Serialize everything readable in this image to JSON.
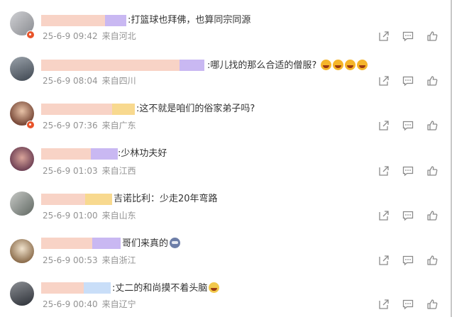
{
  "comments": [
    {
      "text": ":打篮球也拜佛，也算同宗同源",
      "date": "25-6-9 09:42",
      "location": "来自河北",
      "emoji_count": 0,
      "emoji": "",
      "vip": true
    },
    {
      "text": ":哪儿找的那么合适的僧服?",
      "date": "25-6-9 08:04",
      "location": "来自四川",
      "emoji_count": 4,
      "emoji": "laugh-cry-emoji",
      "vip": false
    },
    {
      "text": ":这不就是咱们的俗家弟子吗?",
      "date": "25-6-9 07:36",
      "location": "来自广东",
      "emoji_count": 0,
      "emoji": "",
      "vip": true
    },
    {
      "text": ":少林功夫好",
      "date": "25-6-9 01:03",
      "location": "来自江西",
      "emoji_count": 0,
      "emoji": "",
      "vip": false
    },
    {
      "text": "吉诺比利：少走20年弯路",
      "date": "25-6-9 01:00",
      "location": "来自山东",
      "emoji_count": 0,
      "emoji": "",
      "vip": false
    },
    {
      "text": "哥们来真的",
      "date": "25-6-9 00:53",
      "location": "来自浙江",
      "emoji_count": 1,
      "emoji": "cat-emoji",
      "vip": false
    },
    {
      "text": ":丈二的和尚摸不着头脑",
      "date": "25-6-9 00:40",
      "location": "来自辽宁",
      "emoji_count": 1,
      "emoji": "sweat-laugh-emoji",
      "vip": false
    }
  ],
  "icons": {
    "share": "share-icon",
    "comment": "comment-icon",
    "like": "thumbs-up-icon"
  },
  "colors": {
    "meta": "#939393",
    "text": "#333333",
    "accent_purple": "#c9b8f2",
    "vip_badge": "#e8542b"
  }
}
